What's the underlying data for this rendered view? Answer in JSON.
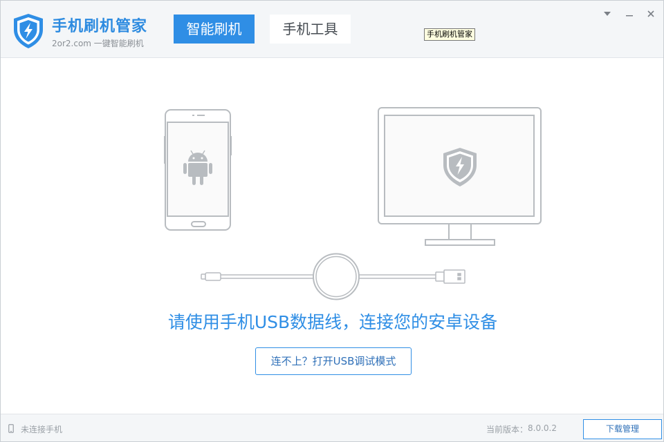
{
  "header": {
    "app_title": "手机刷机管家",
    "app_subtitle": "2or2.com 一键智能刷机",
    "tabs": [
      {
        "label": "智能刷机",
        "active": true
      },
      {
        "label": "手机工具",
        "active": false
      }
    ],
    "tooltip": "手机刷机管家"
  },
  "main": {
    "instruction": "请使用手机USB数据线，连接您的安卓设备",
    "usb_debug_button": "连不上？打开USB调试模式",
    "icons": [
      "android-phone-icon",
      "monitor-icon",
      "shield-lightning-icon",
      "usb-cable-icon"
    ]
  },
  "statusbar": {
    "connection_status": "未连接手机",
    "version_label": "当前版本：",
    "version_value": "8.0.0.2",
    "download_manager": "下载管理"
  },
  "colors": {
    "accent": "#2f8ee5",
    "header_bg": "#f4f6f8",
    "illustration_gray": "#b8bcc0"
  }
}
